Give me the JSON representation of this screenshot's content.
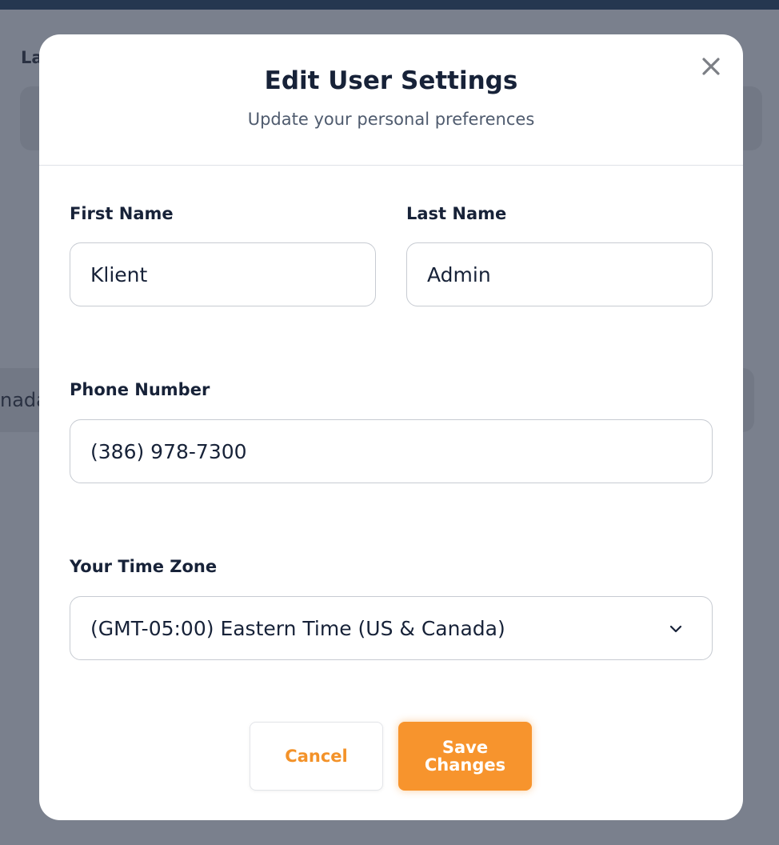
{
  "background": {
    "label_fragment": "La",
    "field_fragment": "nada"
  },
  "modal": {
    "title": "Edit User Settings",
    "subtitle": "Update your personal preferences",
    "close_icon": "close-icon"
  },
  "form": {
    "first_name": {
      "label": "First Name",
      "value": "Klient"
    },
    "last_name": {
      "label": "Last Name",
      "value": "Admin"
    },
    "phone": {
      "label": "Phone Number",
      "value": "(386) 978-7300"
    },
    "time_zone": {
      "label": "Your Time Zone",
      "value": "(GMT-05:00) Eastern Time (US & Canada)",
      "icon": "chevron-down-icon"
    }
  },
  "actions": {
    "cancel_label": "Cancel",
    "save_label_line1": "Save",
    "save_label_line2": "Changes"
  },
  "colors": {
    "accent": "#f7942d",
    "title": "#172238",
    "overlay": "#7a808d",
    "topbar": "#253750"
  }
}
